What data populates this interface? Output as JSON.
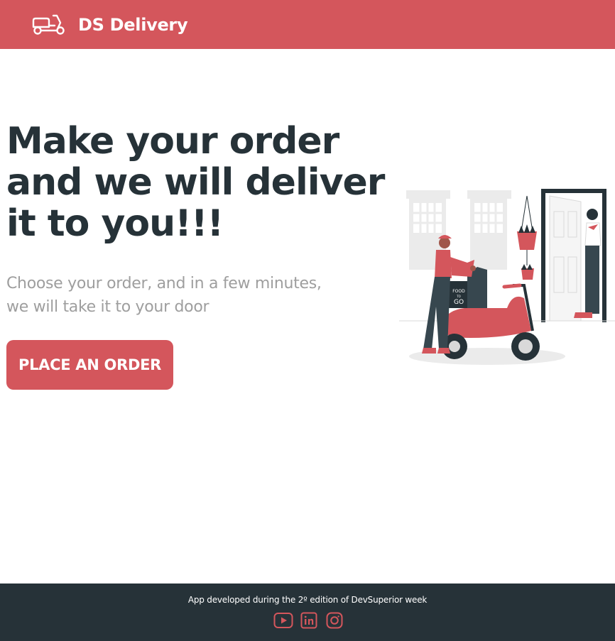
{
  "navbar": {
    "brand": "DS Delivery",
    "logo_icon": "scooter-icon",
    "color": "#d4565c"
  },
  "hero": {
    "title": "Make your order and we will deliver it to you!!!",
    "subtitle": "Choose your order, and in a few minutes, we will take it to your door",
    "button_label": "PLACE AN ORDER",
    "illustration_text_top": "FOOD",
    "illustration_text_mid": "TO",
    "illustration_text_bottom": "GO"
  },
  "footer": {
    "text": "App developed during the 2º edition of DevSuperior week",
    "icons": [
      "youtube-icon",
      "linkedin-icon",
      "instagram-icon"
    ]
  },
  "colors": {
    "primary": "#d4565c",
    "dark": "#263238",
    "muted": "#9e9e9e"
  }
}
